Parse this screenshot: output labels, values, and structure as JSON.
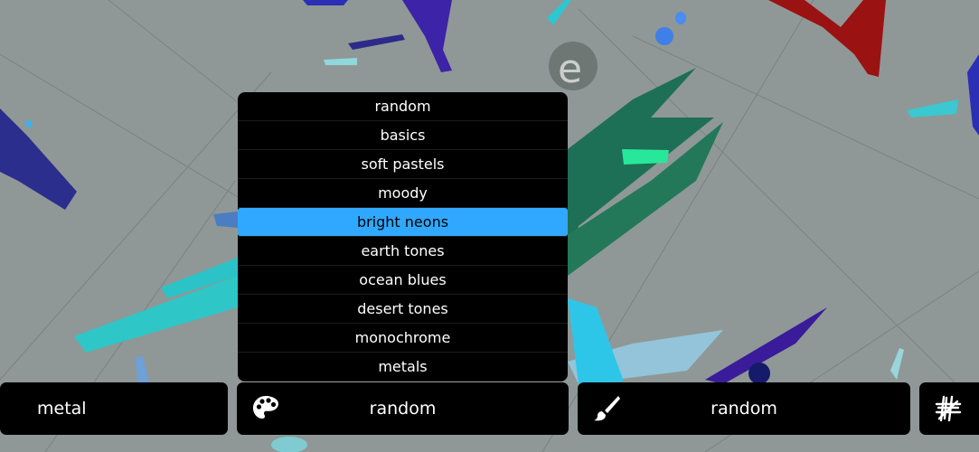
{
  "background": {
    "base_color": "#8f9896"
  },
  "palette_menu": {
    "items": [
      "random",
      "basics",
      "soft pastels",
      "moody",
      "bright neons",
      "earth tones",
      "ocean blues",
      "desert tones",
      "monochrome",
      "metals"
    ],
    "selected": "bright neons",
    "highlight_color": "#31a8ff"
  },
  "toolbar": {
    "texture_label": "metal",
    "palette_label": "random",
    "brush_label": "random",
    "palette_icon": "palette-icon",
    "brush_icon": "paintbrush-icon",
    "grid_icon": "hashtag-scribble-icon"
  }
}
